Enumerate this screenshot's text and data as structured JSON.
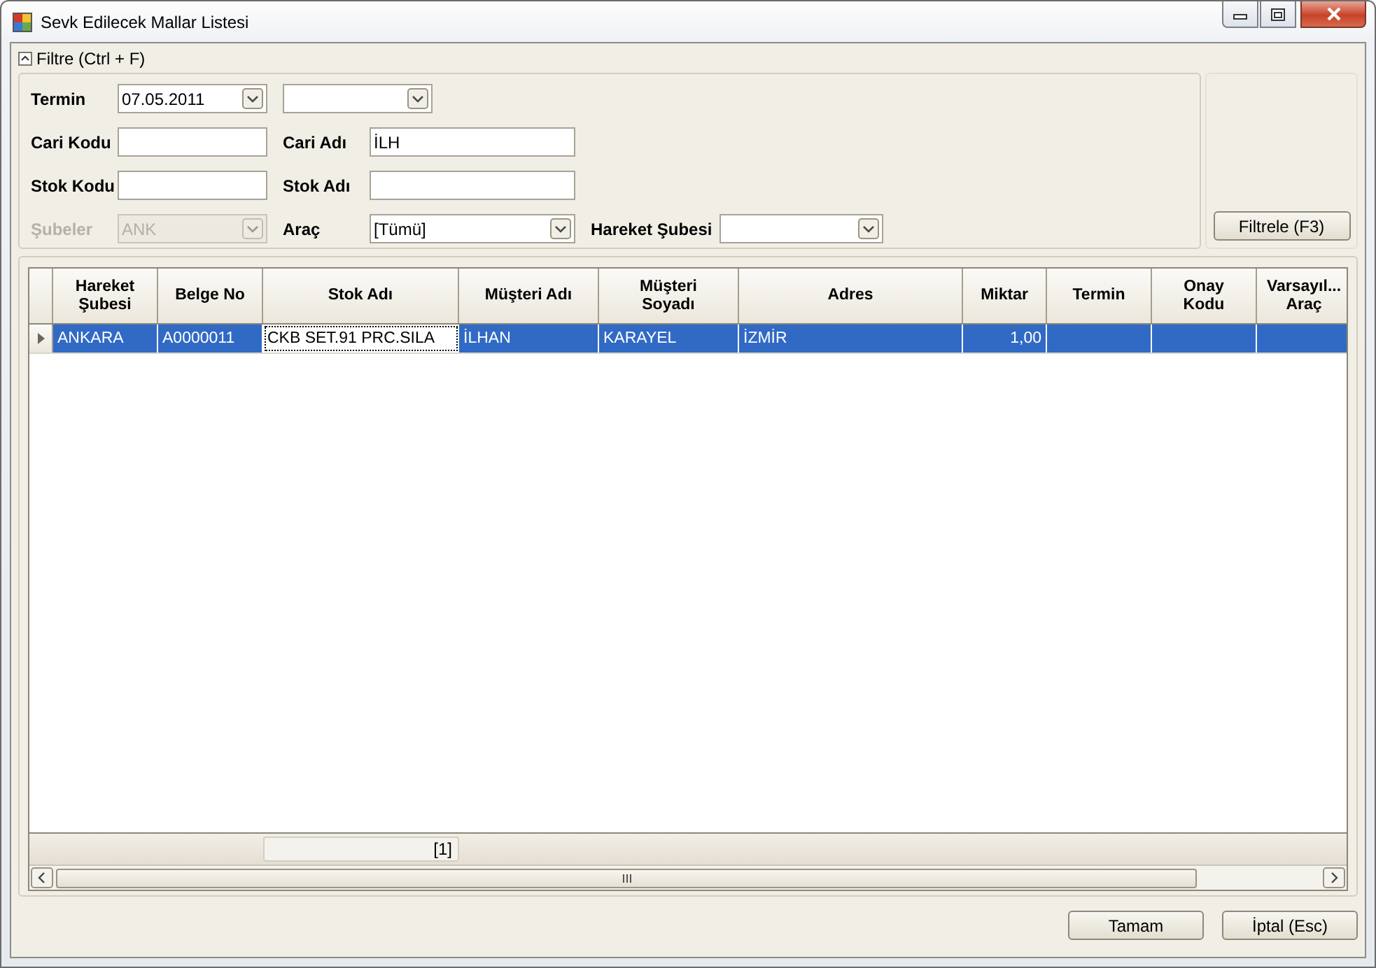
{
  "window": {
    "title": "Sevk Edilecek Mallar Listesi"
  },
  "filter": {
    "header": "Filtre (Ctrl + F)",
    "expanded": true,
    "button": "Filtrele (F3)",
    "rows": [
      [
        {
          "kind": "combo",
          "label": "Termin",
          "value": "07.05.2011",
          "disabled": false
        },
        {
          "kind": "combo",
          "disabled": false
        }
      ],
      [
        {
          "kind": "text",
          "label": "Cari Kodu",
          "disabled": false
        },
        {
          "kind": "text",
          "label": "Cari Adı",
          "value": "İLH",
          "disabled": false
        }
      ],
      [
        {
          "kind": "text",
          "label": "Stok Kodu",
          "disabled": false
        },
        {
          "kind": "text",
          "label": "Stok Adı",
          "disabled": false
        }
      ],
      [
        {
          "kind": "combo",
          "label": "Şubeler",
          "value": "ANK",
          "disabled": true
        },
        {
          "kind": "combo",
          "label": "Araç",
          "value": "[Tümü]",
          "disabled": false
        },
        {
          "kind": "combo",
          "label": "Hareket Şubesi",
          "disabled": false
        }
      ]
    ]
  },
  "grid": {
    "columns": [
      {
        "lines": [
          "Hareket",
          "Şubesi"
        ],
        "kind": "text"
      },
      {
        "lines": [
          "Belge No"
        ],
        "kind": "text"
      },
      {
        "lines": [
          "Stok Adı"
        ],
        "kind": "text",
        "footer": "[1]"
      },
      {
        "lines": [
          "Müşteri Adı"
        ],
        "kind": "text"
      },
      {
        "lines": [
          "Müşteri",
          "Soyadı"
        ],
        "kind": "text"
      },
      {
        "lines": [
          "Adres"
        ],
        "kind": "text"
      },
      {
        "lines": [
          "Miktar"
        ],
        "kind": "number"
      },
      {
        "lines": [
          "Termin"
        ],
        "kind": "text"
      },
      {
        "lines": [
          "Onay",
          "Kodu"
        ],
        "kind": "text"
      },
      {
        "lines": [
          "Varsayıl...",
          "Araç"
        ],
        "kind": "text"
      }
    ],
    "rows": [
      {
        "selected": true,
        "current": true,
        "cells": [
          {
            "text": "ANKARA",
            "focused": false
          },
          {
            "text": "A0000011",
            "focused": false
          },
          {
            "text": "CKB SET.91 PRC.SILA",
            "focused": true
          },
          {
            "text": "İLHAN",
            "focused": false
          },
          {
            "text": "KARAYEL",
            "focused": false
          },
          {
            "text": "İZMİR",
            "focused": false
          },
          {
            "text": "1,00",
            "focused": false
          }
        ]
      }
    ]
  },
  "buttons": [
    "Tamam",
    "İptal (Esc)"
  ]
}
